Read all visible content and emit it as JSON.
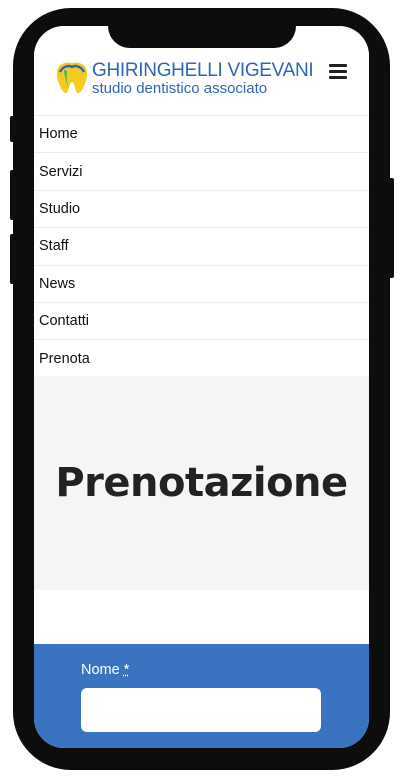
{
  "brand": {
    "name": "GHIRINGHELLI VIGEVANI",
    "tagline": "studio dentistico associato"
  },
  "nav": {
    "items": [
      {
        "label": "Home"
      },
      {
        "label": "Servizi"
      },
      {
        "label": "Studio"
      },
      {
        "label": "Staff"
      },
      {
        "label": "News"
      },
      {
        "label": "Contatti"
      },
      {
        "label": "Prenota"
      }
    ]
  },
  "hero": {
    "title": "Prenotazione"
  },
  "form": {
    "name_label": "Nome",
    "required_mark": "*",
    "name_value": ""
  },
  "icons": {
    "logo": "tooth-logo-icon",
    "menu": "hamburger-menu-icon"
  },
  "colors": {
    "brand_blue": "#2f66b3",
    "form_bg": "#3a74c0",
    "hero_bg": "#f5f5f5",
    "logo_yellow": "#f2cc1f",
    "logo_green": "#2fb36a"
  }
}
